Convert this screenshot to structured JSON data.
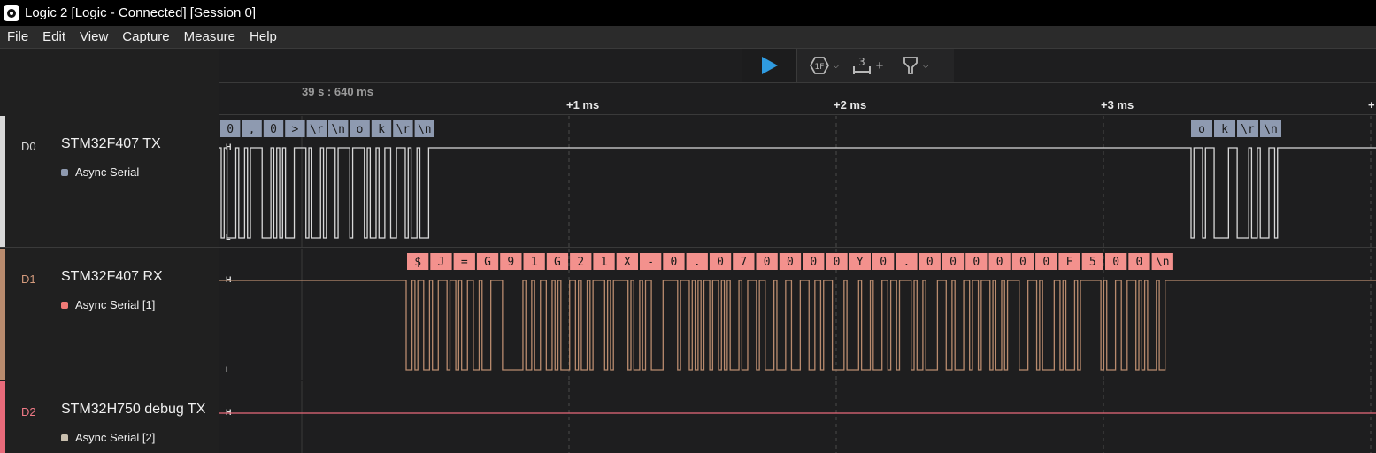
{
  "window": {
    "title": "Logic 2 [Logic - Connected] [Session 0]"
  },
  "menu": [
    "File",
    "Edit",
    "View",
    "Capture",
    "Measure",
    "Help"
  ],
  "toolbar": {
    "play_icon": "play-icon",
    "trigger_icon": "trigger-icon",
    "timing_marker_icon": "timing-marker-icon",
    "timing_marker_count": "3",
    "add_label": "+",
    "measure_icon": "measure-pin-icon"
  },
  "timeline": {
    "origin_label": "39 s : 640 ms",
    "ticks": [
      "+1 ms",
      "+2 ms",
      "+3 ms",
      "+"
    ]
  },
  "channels": [
    {
      "id": "D0",
      "name": "STM32F407 TX",
      "color": "#d9d9d9",
      "id_color": "#d9d9d9",
      "analyzer": {
        "label": "Async Serial",
        "color": "#8e9ab0"
      },
      "high_label": "H",
      "low_label": "L",
      "frame_color": "#8e9ab0",
      "frames_group1": [
        "0",
        ",",
        "0",
        ">",
        "\\r",
        "\\n",
        "o",
        "k",
        "\\r",
        "\\n"
      ],
      "frames_group2": [
        "o",
        "k",
        "\\r",
        "\\n"
      ]
    },
    {
      "id": "D1",
      "name": "STM32F407 RX",
      "color": "#b98b6e",
      "id_color": "#d39a7c",
      "analyzer": {
        "label": "Async Serial [1]",
        "color": "#f07a76"
      },
      "high_label": "H",
      "low_label": "L",
      "frame_color": "#f3918d",
      "frames": [
        "$",
        "J",
        "=",
        "G",
        "9",
        "1",
        "G",
        "2",
        "1",
        "X",
        "-",
        "0",
        ".",
        "0",
        "7",
        "0",
        "0",
        "0",
        "0",
        "Y",
        "0",
        ".",
        "0",
        "0",
        "0",
        "0",
        "0",
        "0",
        "F",
        "5",
        "0",
        "0",
        "\\n"
      ]
    },
    {
      "id": "D2",
      "name": "STM32H750 debug TX",
      "color": "#e86a7a",
      "id_color": "#f07a86",
      "analyzer": {
        "label": "Async Serial [2]",
        "color": "#c9bfae"
      },
      "high_label": "H"
    }
  ]
}
